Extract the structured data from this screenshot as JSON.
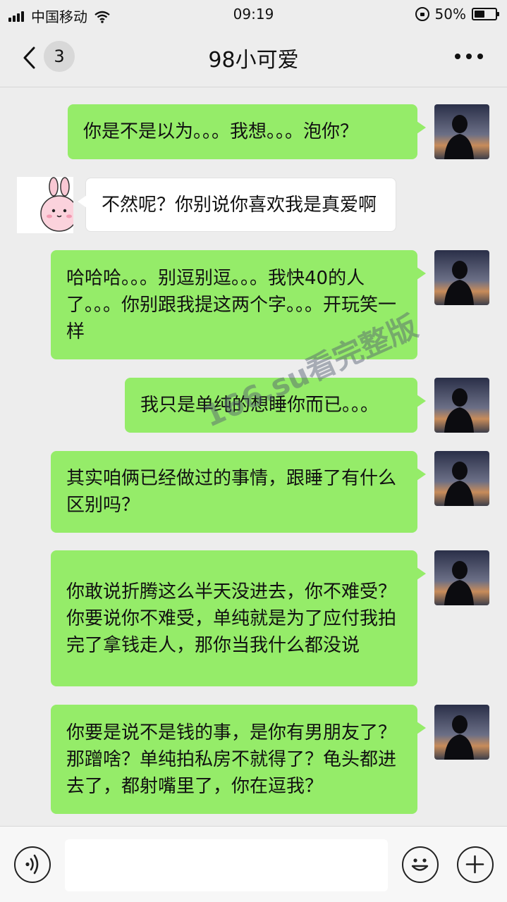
{
  "status_bar": {
    "carrier": "中国移动",
    "time": "09:19",
    "battery": "50%",
    "battery_level": 0.5,
    "icons": [
      "signal-icon",
      "wifi-icon",
      "rotation-lock-icon",
      "battery-icon"
    ]
  },
  "header": {
    "unread_count": "3",
    "title": "98小可爱",
    "back_icon": "chevron-left-icon",
    "more_icon": "more-dots-icon"
  },
  "messages": [
    {
      "sender": "me",
      "text": "你是不是以为。。。我想。。。泡你？"
    },
    {
      "sender": "other",
      "text": "不然呢？你别说你喜欢我是真爱啊"
    },
    {
      "sender": "me",
      "text": "哈哈哈。。。别逗别逗。。。我快40的人了。。。你别跟我提这两个字。。。开玩笑一样"
    },
    {
      "sender": "me",
      "text": "我只是单纯的想睡你而已。。。"
    },
    {
      "sender": "me",
      "text": "其实咱俩已经做过的事情，跟睡了有什么区别吗？"
    },
    {
      "sender": "me",
      "text": "你敢说折腾这么半天没进去，你不难受？你要说你不难受，单纯就是为了应付我拍完了拿钱走人，那你当我什么都没说"
    },
    {
      "sender": "me",
      "text": "你要是说不是钱的事，是你有男朋友了？那蹭啥？单纯拍私房不就得了？龟头都进去了，都射嘴里了，你在逗我？"
    }
  ],
  "watermark": "166.su看完整版",
  "input_bar": {
    "value": "",
    "icons": [
      "voice-icon",
      "emoji-icon",
      "plus-icon"
    ]
  },
  "colors": {
    "background": "#ededed",
    "my_bubble": "#95ec69",
    "their_bubble": "#ffffff"
  }
}
